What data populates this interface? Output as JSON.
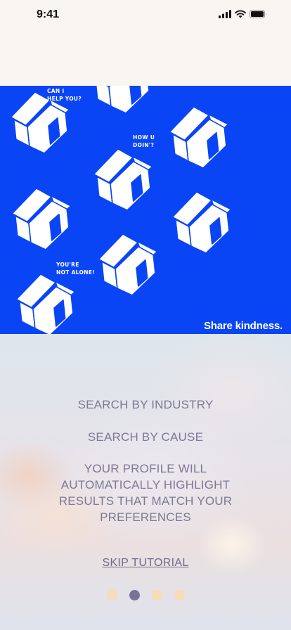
{
  "status_bar": {
    "time": "9:41",
    "icons": [
      "cellular-signal-icon",
      "wifi-icon",
      "battery-icon"
    ]
  },
  "hero": {
    "bubbles": [
      "CAN I\nHELP YOU?",
      "HOW U\nDOIN'?",
      "YOU'RE\nNOT ALONE!"
    ],
    "caption": "Share kindness.",
    "colors": {
      "background": "#0a45f5",
      "house": "#ffffff"
    }
  },
  "features": [
    "SEARCH BY INDUSTRY",
    "SEARCH BY CAUSE",
    "YOUR PROFILE WILL AUTOMATICALLY HIGHLIGHT RESULTS THAT MATCH YOUR PREFERENCES"
  ],
  "skip_label": "SKIP TUTORIAL",
  "pagination": {
    "total": 4,
    "current": 2,
    "colors": {
      "active": "#787399",
      "inactive": "#f7dcb8"
    }
  }
}
